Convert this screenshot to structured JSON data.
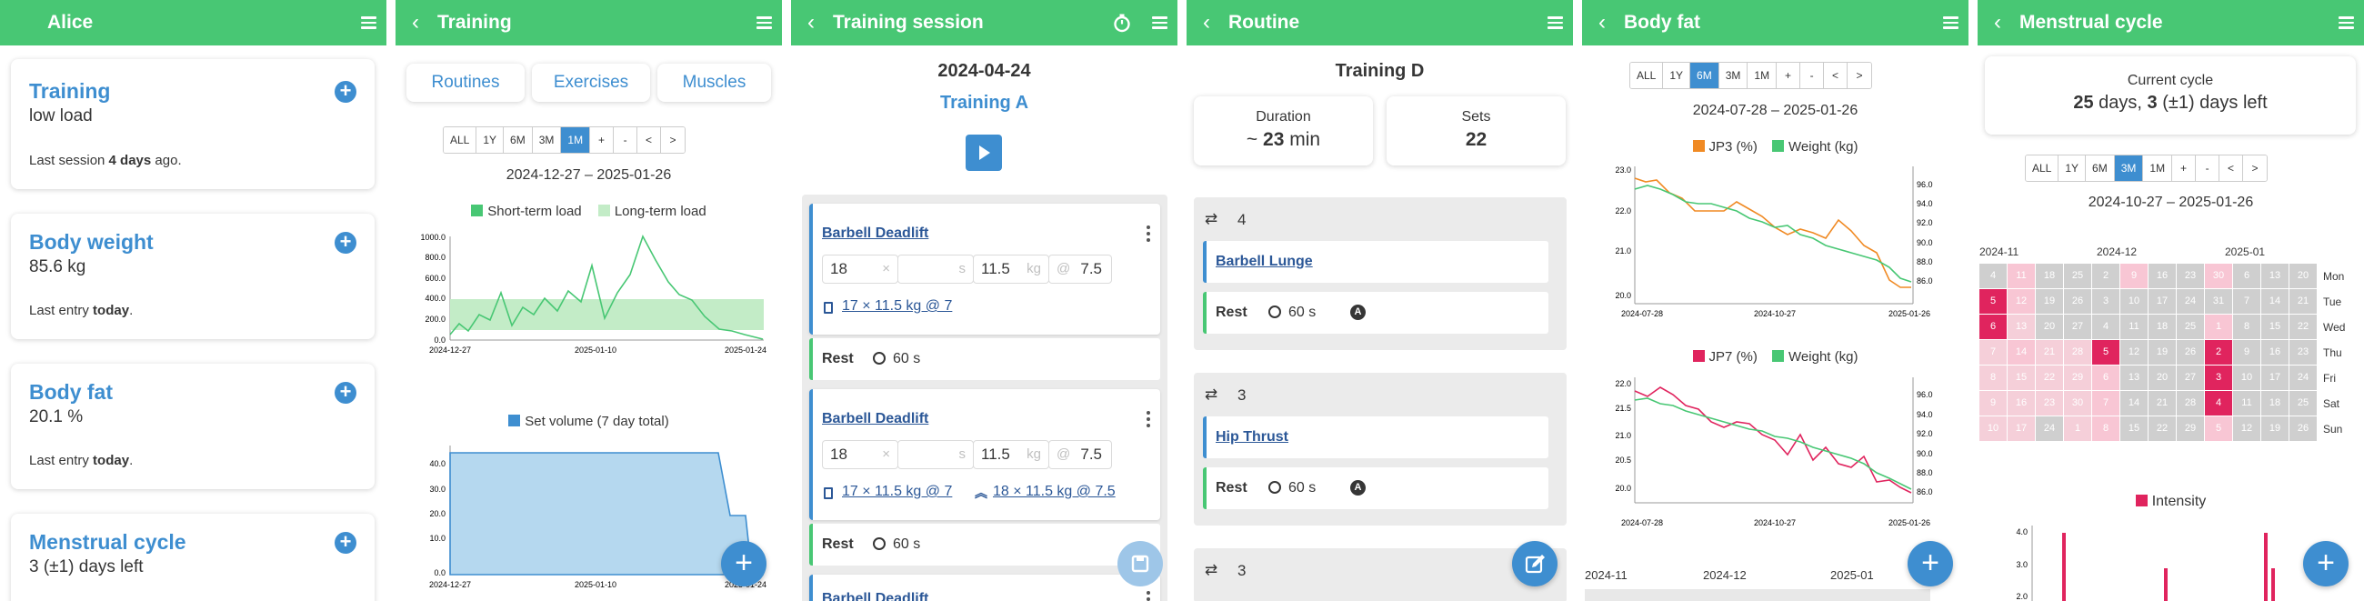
{
  "colors": {
    "green": "#48c774",
    "blue": "#3e8ed0",
    "pink": "#e0245e",
    "orange": "#f08a24"
  },
  "panel1": {
    "title": "Alice",
    "cards": [
      {
        "title": "Training",
        "value": "low load",
        "footer_pre": "Last session ",
        "footer_bold": "4 days",
        "footer_post": " ago."
      },
      {
        "title": "Body weight",
        "value": "85.6 kg",
        "footer_pre": "Last entry ",
        "footer_bold": "today",
        "footer_post": "."
      },
      {
        "title": "Body fat",
        "value": "20.1 %",
        "footer_pre": "Last entry ",
        "footer_bold": "today",
        "footer_post": "."
      },
      {
        "title": "Menstrual cycle",
        "value": "3 (±1) days left"
      }
    ]
  },
  "panel2": {
    "title": "Training",
    "tabs": [
      "Routines",
      "Exercises",
      "Muscles"
    ],
    "range_buttons": [
      "ALL",
      "1Y",
      "6M",
      "3M",
      "1M",
      "+",
      "-",
      "<",
      ">"
    ],
    "range_selected": "1M",
    "date_range": "2024-12-27 – 2025-01-26",
    "load_chart": {
      "legend": [
        "Short-term load",
        "Long-term load"
      ],
      "yticks": [
        "1000.0",
        "800.0",
        "600.0",
        "400.0",
        "200.0",
        "0.0"
      ],
      "xticks": [
        "2024-12-27",
        "2025-01-10",
        "2025-01-24"
      ]
    },
    "volume_chart": {
      "legend": "Set volume (7 day total)",
      "yticks": [
        "40.0",
        "30.0",
        "20.0",
        "10.0",
        "0.0"
      ],
      "xticks": [
        "2024-12-27",
        "2025-01-10",
        "2025-01-24"
      ]
    }
  },
  "panel3": {
    "title": "Training session",
    "date": "2024-04-24",
    "routine": "Training A",
    "sets": [
      {
        "exercise": "Barbell Deadlift",
        "reps": "18",
        "time_unit": "s",
        "weight": "11.5",
        "weight_unit": "kg",
        "at": "@",
        "rpe": "7.5",
        "prev": "17 × 11.5 kg @ 7",
        "target": ""
      },
      {
        "exercise": "Barbell Deadlift",
        "reps": "18",
        "time_unit": "s",
        "weight": "11.5",
        "weight_unit": "kg",
        "at": "@",
        "rpe": "7.5",
        "prev": "17 × 11.5 kg @ 7",
        "target": "18 × 11.5 kg @ 7.5"
      },
      {
        "exercise": "Barbell Deadlift"
      }
    ],
    "rests": [
      {
        "label": "Rest",
        "value": "60 s"
      },
      {
        "label": "Rest",
        "value": "60 s"
      }
    ],
    "times_glyph": "×"
  },
  "panel4": {
    "title": "Routine",
    "name": "Training D",
    "duration_label": "Duration",
    "duration_prefix": "~ ",
    "duration_value": "23",
    "duration_unit": " min",
    "sets_label": "Sets",
    "sets_value": "22",
    "blocks": [
      {
        "repeat": "4",
        "exercise": "Barbell Lunge",
        "rest": "Rest",
        "rest_value": "60 s"
      },
      {
        "repeat": "3",
        "exercise": "Hip Thrust",
        "rest": "Rest",
        "rest_value": "60 s"
      },
      {
        "repeat": "3"
      }
    ]
  },
  "panel5": {
    "title": "Body fat",
    "range_buttons": [
      "ALL",
      "1Y",
      "6M",
      "3M",
      "1M",
      "+",
      "-",
      "<",
      ">"
    ],
    "range_selected": "6M",
    "date_range": "2024-07-28 – 2025-01-26",
    "chart1": {
      "legend": [
        "JP3 (%)",
        "Weight (kg)"
      ],
      "yleft": [
        "23.0",
        "22.0",
        "21.0",
        "20.0"
      ],
      "yright": [
        "96.0",
        "94.0",
        "92.0",
        "90.0",
        "88.0",
        "86.0"
      ],
      "xticks": [
        "2024-07-28",
        "2024-10-27",
        "2025-01-26"
      ]
    },
    "chart2": {
      "legend": [
        "JP7 (%)",
        "Weight (kg)"
      ],
      "yleft": [
        "22.0",
        "21.5",
        "21.0",
        "20.5",
        "20.0"
      ],
      "yright": [
        "96.0",
        "94.0",
        "92.0",
        "90.0",
        "88.0",
        "86.0"
      ],
      "xticks": [
        "2024-07-28",
        "2024-10-27",
        "2025-01-26"
      ]
    },
    "months": [
      "2024-11",
      "2024-12",
      "2025-01"
    ]
  },
  "panel6": {
    "title": "Menstrual cycle",
    "current_label": "Current cycle",
    "cycle_days": "25",
    "cycle_mid": " days, ",
    "days_left": "3",
    "cycle_tail": " (±1) days left",
    "range_buttons": [
      "ALL",
      "1Y",
      "6M",
      "3M",
      "1M",
      "+",
      "-",
      "<",
      ">"
    ],
    "range_selected": "3M",
    "date_range": "2024-10-27 – 2025-01-26",
    "months": [
      "2024-11",
      "2024-12",
      "2025-01"
    ],
    "weekdays": [
      "Mon",
      "Tue",
      "Wed",
      "Thu",
      "Fri",
      "Sat",
      "Sun"
    ],
    "calendar": [
      [
        "4",
        "11",
        "18",
        "25",
        "2",
        "9",
        "16",
        "23",
        "30",
        "6",
        "13",
        "20"
      ],
      [
        "5",
        "12",
        "19",
        "26",
        "3",
        "10",
        "17",
        "24",
        "31",
        "7",
        "14",
        "21"
      ],
      [
        "6",
        "13",
        "20",
        "27",
        "4",
        "11",
        "18",
        "25",
        "1",
        "8",
        "15",
        "22"
      ],
      [
        "7",
        "14",
        "21",
        "28",
        "5",
        "12",
        "19",
        "26",
        "2",
        "9",
        "16",
        "23"
      ],
      [
        "8",
        "15",
        "22",
        "29",
        "6",
        "13",
        "20",
        "27",
        "3",
        "10",
        "17",
        "24"
      ],
      [
        "9",
        "16",
        "23",
        "30",
        "7",
        "14",
        "21",
        "28",
        "4",
        "11",
        "18",
        "25"
      ],
      [
        "10",
        "17",
        "24",
        "1",
        "8",
        "15",
        "22",
        "29",
        "5",
        "12",
        "19",
        "26"
      ]
    ],
    "intensity_label": "Intensity",
    "intensity_yticks": [
      "4.0",
      "3.0",
      "2.0"
    ]
  }
}
